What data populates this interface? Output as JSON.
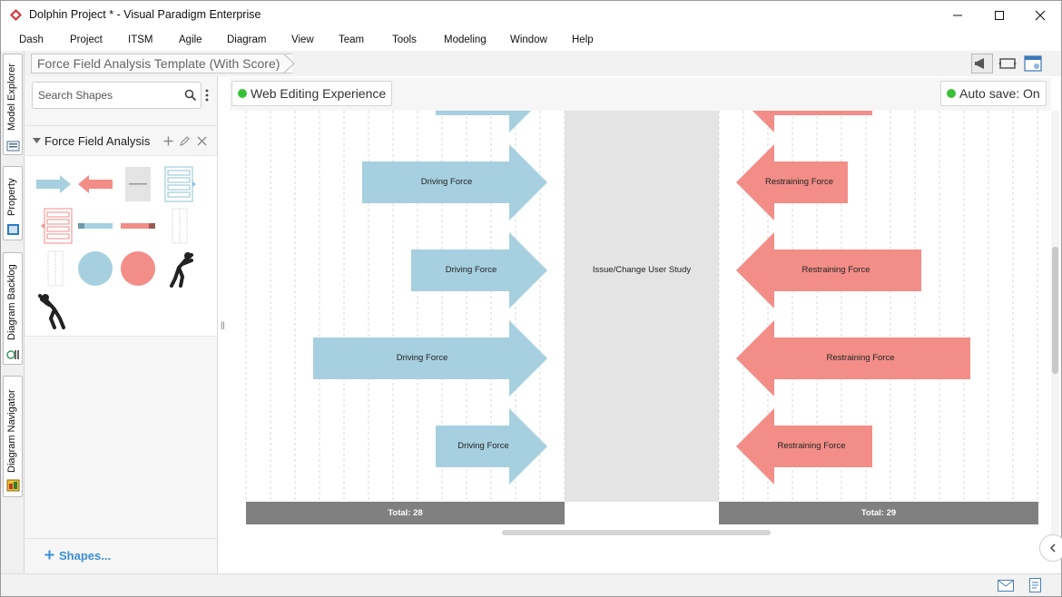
{
  "window": {
    "title": "Dolphin Project * - Visual Paradigm Enterprise",
    "controls": [
      "minimize",
      "maximize",
      "close"
    ]
  },
  "menu": [
    "Dash",
    "Project",
    "ITSM",
    "Agile",
    "Diagram",
    "View",
    "Team",
    "Tools",
    "Modeling",
    "Window",
    "Help"
  ],
  "side_tabs": [
    "Model Explorer",
    "Property",
    "Diagram Backlog",
    "Diagram Navigator"
  ],
  "breadcrumb": "Force Field Analysis Template (With Score)",
  "left_panel": {
    "search_placeholder": "Search Shapes",
    "section_title": "Force Field Analysis",
    "shapes_link": "Shapes...",
    "stencil_icons": [
      "driving-force-shape-icon",
      "restraining-force-shape-icon",
      "issue-shape-icon",
      "driving-force-list-icon",
      "restraining-force-list-icon",
      "driving-score-bar-icon",
      "restraining-score-bar-icon",
      "score-grid-icon",
      "score-grid-2-icon",
      "driving-circle-icon",
      "restraining-circle-icon",
      "pushing-person-icon",
      "pulling-person-icon"
    ]
  },
  "canvas_header": {
    "diagram_name": "Web Editing Experience",
    "autosave": "Auto save: On"
  },
  "diagram": {
    "issue_label": "Issue/Change User Study",
    "driving_forces": [
      {
        "label": "",
        "score": 3
      },
      {
        "label": "Driving Force",
        "score": 6
      },
      {
        "label": "Driving Force",
        "score": 4
      },
      {
        "label": "Driving Force",
        "score": 8
      },
      {
        "label": "Driving Force",
        "score": 3
      }
    ],
    "restraining_forces": [
      {
        "label": "",
        "score": 4
      },
      {
        "label": "Restraining Force",
        "score": 3
      },
      {
        "label": "Restraining Force",
        "score": 6
      },
      {
        "label": "Restraining Force",
        "score": 8
      },
      {
        "label": "Restraining Force",
        "score": 4
      }
    ],
    "driving_total": "Total: 28",
    "restraining_total": "Total: 29",
    "colors": {
      "driving": "#a6d0df",
      "restraining": "#f28d88",
      "issue_bg": "#e4e4e4",
      "total_bg": "#808080",
      "accent": "#3c8fd6"
    }
  }
}
